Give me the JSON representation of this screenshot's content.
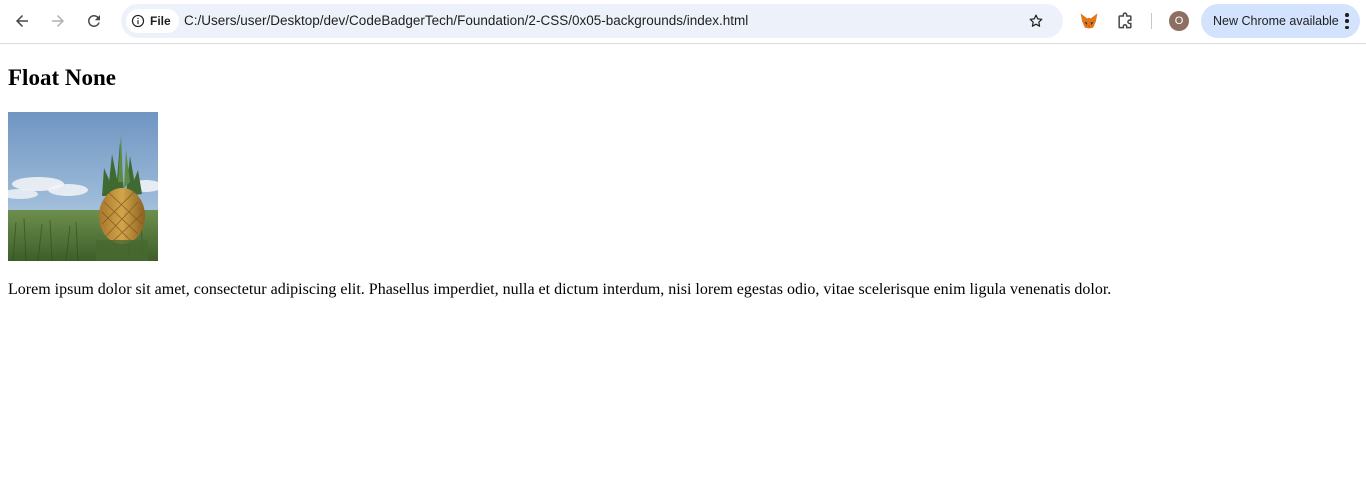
{
  "browser": {
    "site_chip_label": "File",
    "url": "C:/Users/user/Desktop/dev/CodeBadgerTech/Foundation/2-CSS/0x05-backgrounds/index.html",
    "profile_initial": "O",
    "update_button_label": "New Chrome available",
    "icons": {
      "back": "arrow-left",
      "forward": "arrow-right",
      "reload": "reload",
      "site_info": "info-circle",
      "bookmark": "star-outline",
      "extension_metamask": "fox",
      "extensions": "puzzle-piece",
      "menu": "three-dots-vertical"
    }
  },
  "page": {
    "heading": "Float None",
    "paragraph": "Lorem ipsum dolor sit amet, consectetur adipiscing elit. Phasellus imperdiet, nulla et dictum interdum, nisi lorem egestas odio, vitae scelerisque enim ligula venenatis dolor."
  },
  "colors": {
    "omnibox_bg": "#edf2fa",
    "update_button_bg": "#d3e3fd",
    "avatar_bg": "#8d6e63"
  }
}
